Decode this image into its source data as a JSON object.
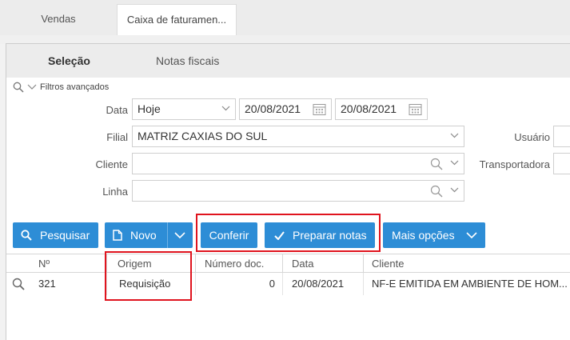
{
  "tabs": [
    {
      "label": "Vendas"
    },
    {
      "label": "Caixa de faturamen..."
    }
  ],
  "subtabs": {
    "selecao": "Seleção",
    "notas": "Notas fiscais"
  },
  "filters": {
    "advanced_label": "Filtros avançados",
    "data_label": "Data",
    "data_value": "Hoje",
    "date_from": "20/08/2021",
    "date_to": "20/08/2021",
    "filial_label": "Filial",
    "filial_value": "MATRIZ CAXIAS DO SUL",
    "cliente_label": "Cliente",
    "cliente_value": "",
    "linha_label": "Linha",
    "linha_value": "",
    "usuario_label": "Usuário",
    "transportadora_label": "Transportadora"
  },
  "buttons": {
    "pesquisar": "Pesquisar",
    "novo": "Novo",
    "conferir": "Conferir",
    "preparar": "Preparar notas",
    "mais": "Mais opções"
  },
  "grid": {
    "columns": [
      "Nº",
      "Origem",
      "Número doc.",
      "Data",
      "Cliente"
    ],
    "rows": [
      {
        "numero": "321",
        "origem": "Requisição",
        "numero_doc": "0",
        "data": "20/08/2021",
        "cliente": "NF-E EMITIDA EM AMBIENTE DE HOM..."
      }
    ]
  },
  "colors": {
    "accent": "#2d8dd6",
    "highlight": "#e0141e"
  }
}
